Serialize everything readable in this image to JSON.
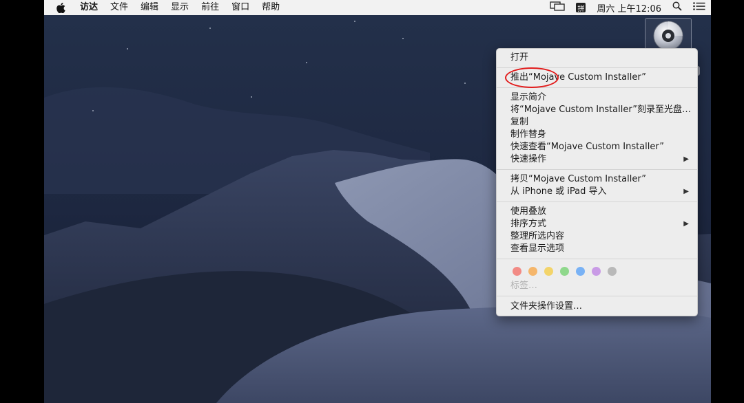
{
  "menubar": {
    "items": [
      "访达",
      "文件",
      "编辑",
      "显示",
      "前往",
      "窗口",
      "帮助"
    ],
    "ime_label": "拼",
    "clock": "周六 上午12:06"
  },
  "context_menu": {
    "open": "打开",
    "eject": "推出“Mojave Custom Installer”",
    "get_info": "显示简介",
    "burn": "将“Mojave Custom Installer”刻录至光盘…",
    "duplicate": "复制",
    "make_alias": "制作替身",
    "quick_look": "快速查看“Mojave Custom Installer”",
    "quick_actions": "快速操作",
    "copy": "拷贝“Mojave Custom Installer”",
    "import_iphone": "从 iPhone 或 iPad 导入",
    "use_stacks": "使用叠放",
    "sort_by": "排序方式",
    "clean_up": "整理所选内容",
    "view_options": "查看显示选项",
    "tags_label": "标签…",
    "folder_actions": "文件夹操作设置…",
    "tag_colors": [
      "#f28b85",
      "#f5b66b",
      "#f3d46a",
      "#8fd88c",
      "#79b2f5",
      "#c99be6",
      "#b9b9b9"
    ]
  }
}
